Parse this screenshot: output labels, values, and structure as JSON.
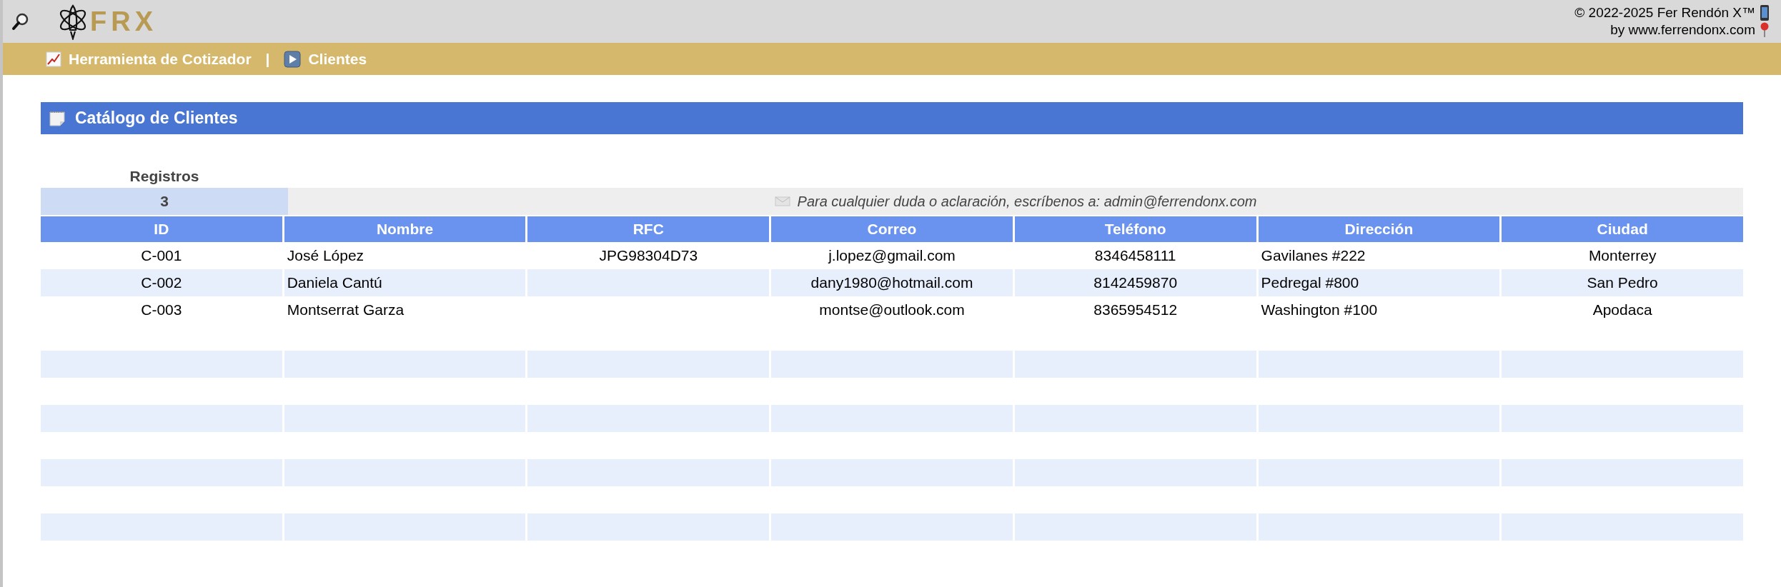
{
  "header": {
    "logo_text": "FRX",
    "copyright": "© 2022-2025 Fer Rendón X™",
    "byline": "by www.ferrendonx.com"
  },
  "breadcrumb": {
    "items": [
      {
        "label": "Herramienta de Cotizador",
        "kind": "chart"
      },
      {
        "label": "Clientes",
        "kind": "play"
      }
    ],
    "separator": "|"
  },
  "panel": {
    "title": "Catálogo de Clientes"
  },
  "records": {
    "label": "Registros",
    "count": "3",
    "notice": "Para cualquier duda o aclaración, escríbenos a: admin@ferrendonx.com"
  },
  "table": {
    "columns": [
      "ID",
      "Nombre",
      "RFC",
      "Correo",
      "Teléfono",
      "Dirección",
      "Ciudad"
    ],
    "rows": [
      [
        "C-001",
        "José López",
        "JPG98304D73",
        "j.lopez@gmail.com",
        "8346458111",
        "Gavilanes #222",
        "Monterrey"
      ],
      [
        "C-002",
        "Daniela Cantú",
        "",
        "dany1980@hotmail.com",
        "8142459870",
        "Pedregal #800",
        "San Pedro"
      ],
      [
        "C-003",
        "Montserrat Garza",
        "",
        "montse@outlook.com",
        "8365954512",
        "Washington #100",
        "Apodaca"
      ]
    ]
  }
}
